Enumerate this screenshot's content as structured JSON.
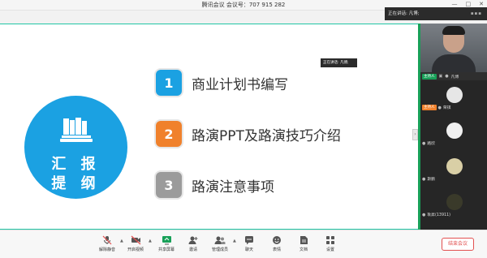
{
  "window": {
    "title": "腾讯会议  会议号：707 915 282",
    "controls": [
      "—",
      "□",
      "✕"
    ]
  },
  "speaking_banner": {
    "label": "正在讲话: 凡博;",
    "mid_label": "正在讲话: 凡博;"
  },
  "slide": {
    "circle_line1": "汇 报",
    "circle_line2": "提 纲",
    "items": [
      {
        "num": "1",
        "text": "商业计划书编写",
        "color": "#1ba1e2"
      },
      {
        "num": "2",
        "text": "路演PPT及路演技巧介绍",
        "color": "#f0812c"
      },
      {
        "num": "3",
        "text": "路演注意事项",
        "color": "#9b9b9b"
      }
    ]
  },
  "panel": {
    "main_video": {
      "badge": "主持人",
      "name": "凡博"
    },
    "participants": [
      {
        "badge": "主持人",
        "name": "荣祺"
      },
      {
        "badge": "",
        "name": "路欣"
      },
      {
        "badge": "",
        "name": "斯鹏"
      },
      {
        "badge": "",
        "name": "耿昇(13911)"
      }
    ]
  },
  "toolbar": {
    "buttons": [
      {
        "label": "解除静音",
        "icon": "mic-muted-icon"
      },
      {
        "label": "开启视频",
        "icon": "camera-off-icon"
      },
      {
        "label": "共享屏幕",
        "icon": "share-screen-icon"
      },
      {
        "label": "邀请",
        "icon": "invite-icon"
      },
      {
        "label": "管理成员",
        "icon": "members-icon"
      },
      {
        "label": "聊天",
        "icon": "chat-icon"
      },
      {
        "label": "表情",
        "icon": "emoji-icon"
      },
      {
        "label": "文档",
        "icon": "document-icon"
      },
      {
        "label": "设置",
        "icon": "settings-icon"
      }
    ],
    "end_label": "结束会议"
  },
  "colors": {
    "accent_blue": "#1ba1e2",
    "accent_orange": "#f0812c",
    "green": "#18a058",
    "end_red": "#e25050"
  }
}
